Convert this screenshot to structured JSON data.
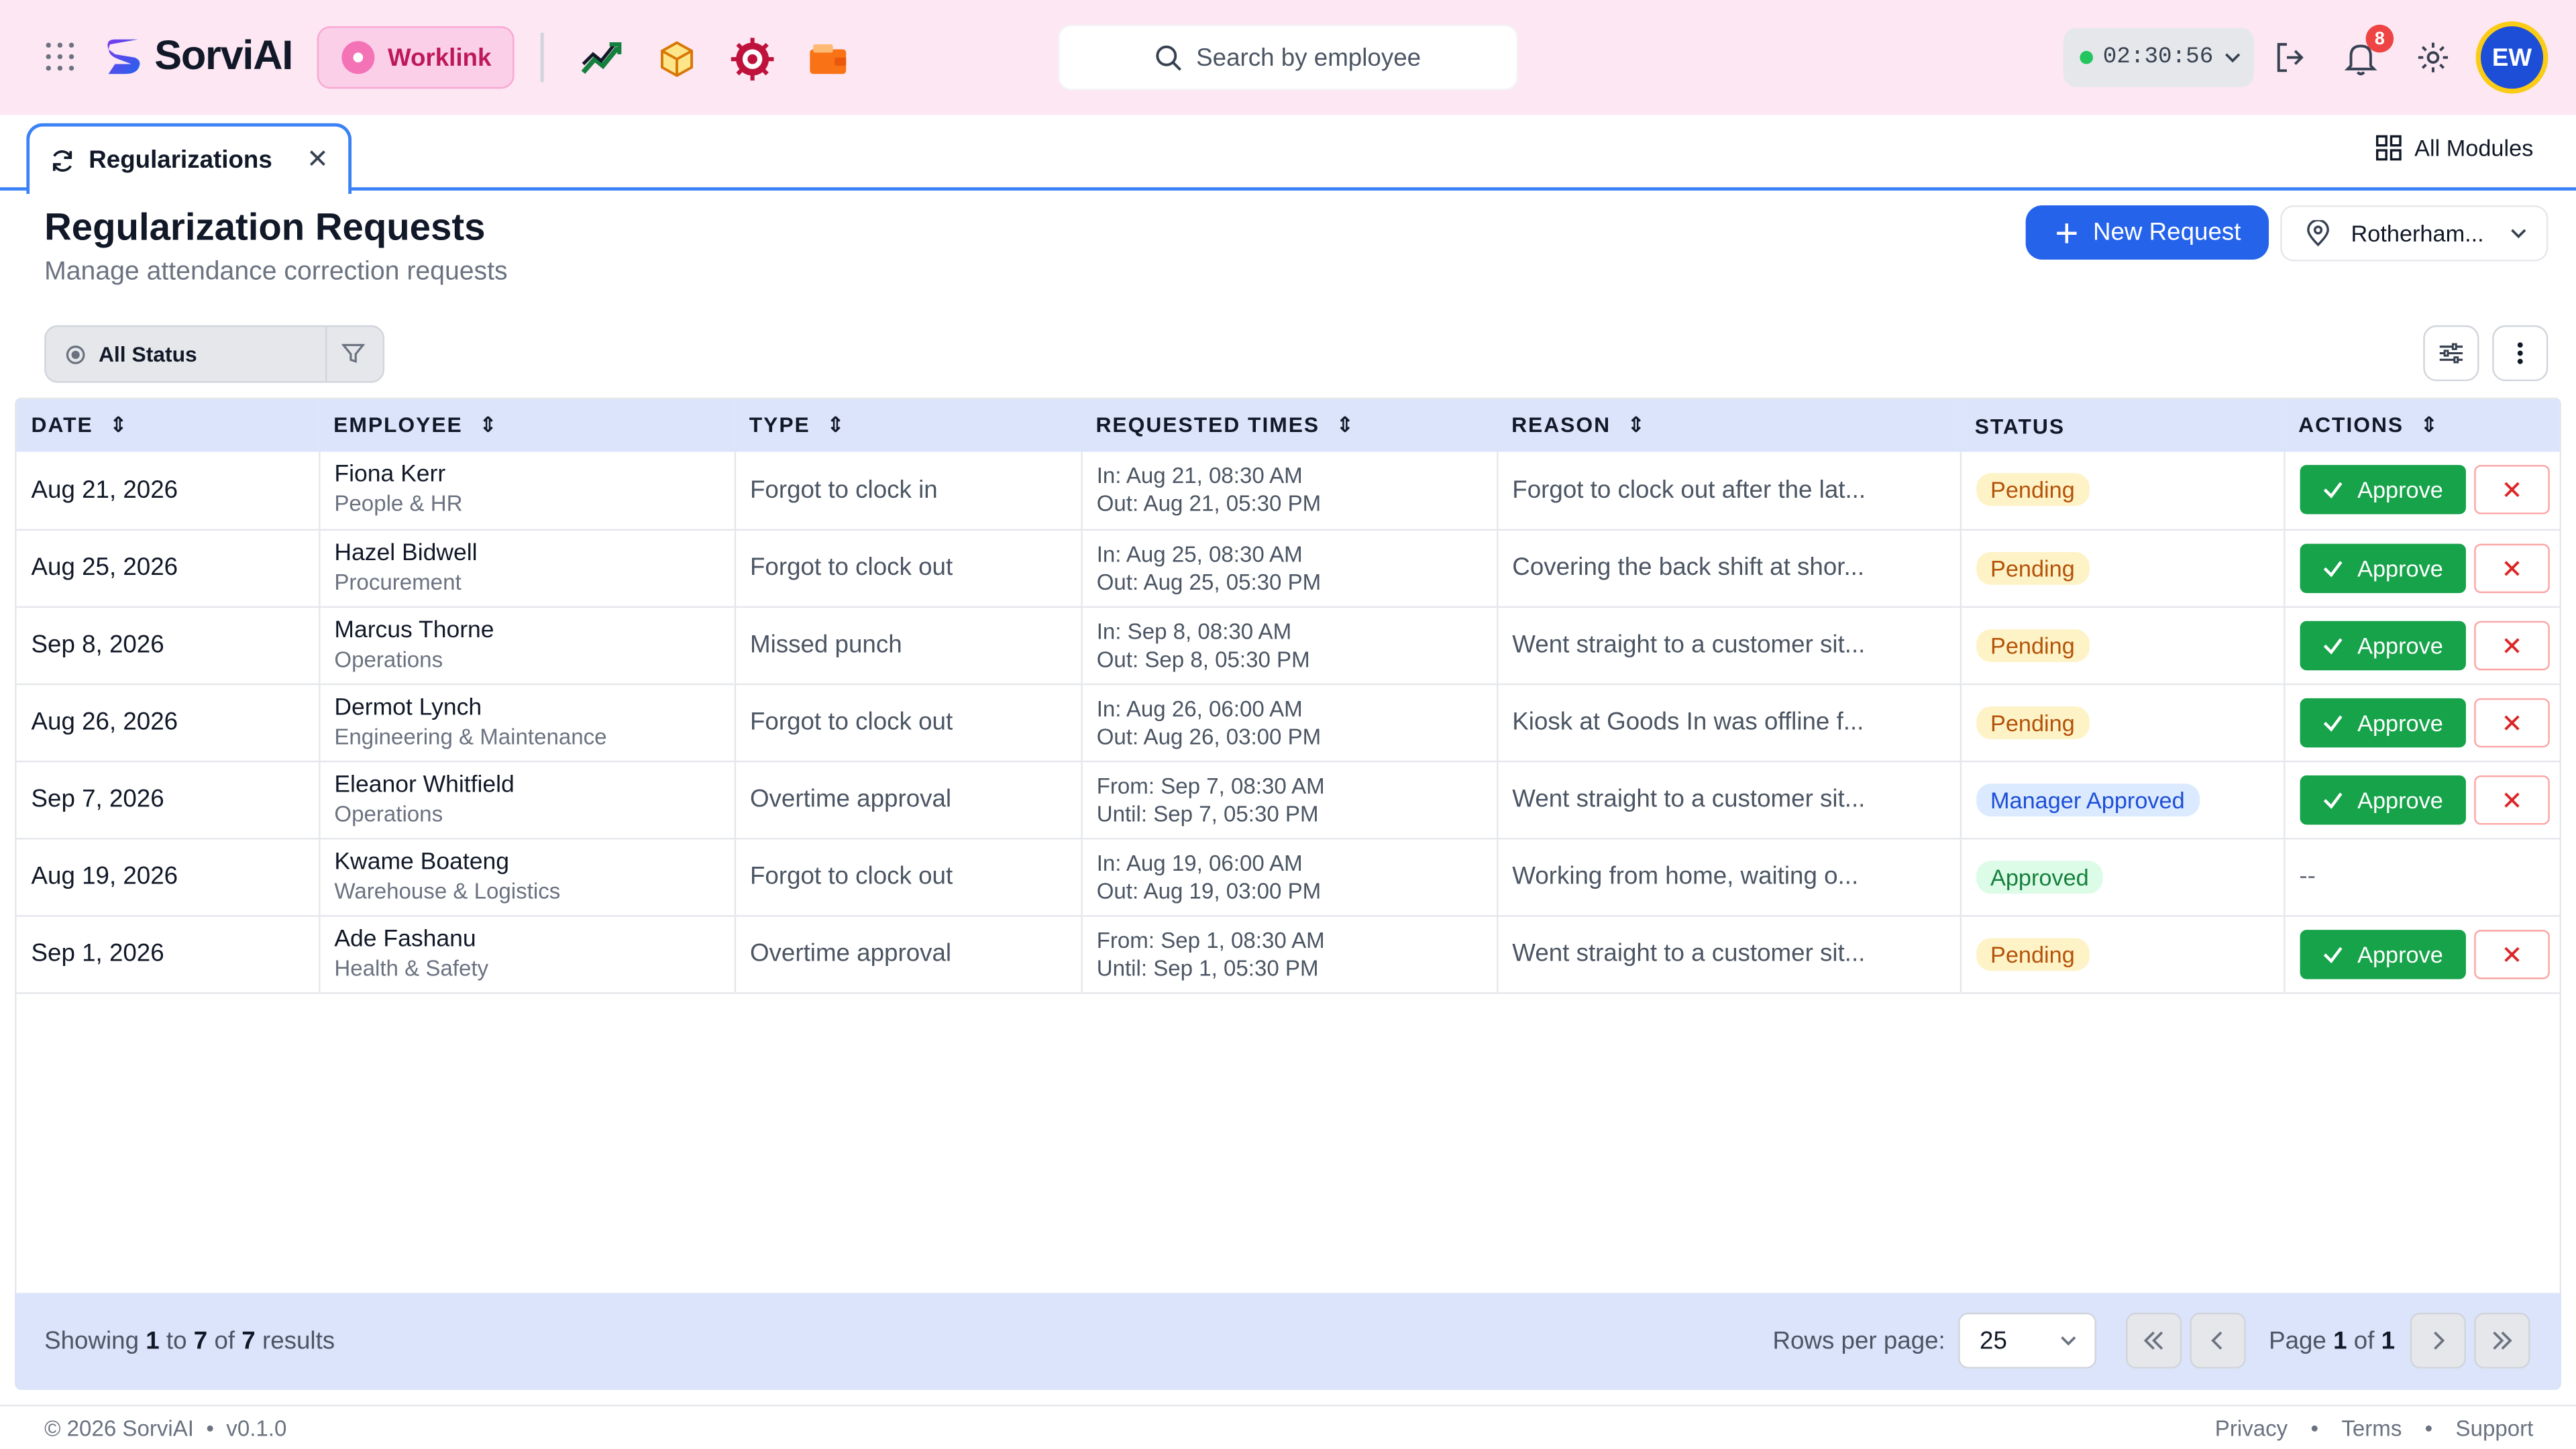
{
  "header": {
    "brand": "SorviAI",
    "app_pill": "Worklink",
    "search_placeholder": "Search by employee",
    "timer": "02:30:56",
    "notification_count": "8",
    "avatar_initials": "EW",
    "module_icons": [
      "analytics-icon",
      "box-icon",
      "gear-target-icon",
      "wallet-icon"
    ]
  },
  "tabs": {
    "active_label": "Regularizations",
    "all_modules": "All Modules"
  },
  "page": {
    "title": "Regularization Requests",
    "subtitle": "Manage attendance correction requests",
    "new_request": "New Request",
    "location": "Rotherham...",
    "status_filter": "All Status"
  },
  "table": {
    "headers": {
      "date": "DATE",
      "employee": "EMPLOYEE",
      "type": "TYPE",
      "times": "REQUESTED TIMES",
      "reason": "REASON",
      "status": "STATUS",
      "actions": "ACTIONS"
    },
    "approve_label": "Approve",
    "no_actions": "--",
    "rows": [
      {
        "date": "Aug 21, 2026",
        "name": "Fiona Kerr",
        "dept": "People & HR",
        "type": "Forgot to clock in",
        "t1": "In: Aug 21, 08:30 AM",
        "t2": "Out: Aug 21, 05:30 PM",
        "reason": "Forgot to clock out after the lat...",
        "status": "Pending"
      },
      {
        "date": "Aug 25, 2026",
        "name": "Hazel Bidwell",
        "dept": "Procurement",
        "type": "Forgot to clock out",
        "t1": "In: Aug 25, 08:30 AM",
        "t2": "Out: Aug 25, 05:30 PM",
        "reason": "Covering the back shift at shor...",
        "status": "Pending"
      },
      {
        "date": "Sep 8, 2026",
        "name": "Marcus Thorne",
        "dept": "Operations",
        "type": "Missed punch",
        "t1": "In: Sep 8, 08:30 AM",
        "t2": "Out: Sep 8, 05:30 PM",
        "reason": "Went straight to a customer sit...",
        "status": "Pending"
      },
      {
        "date": "Aug 26, 2026",
        "name": "Dermot Lynch",
        "dept": "Engineering & Maintenance",
        "type": "Forgot to clock out",
        "t1": "In: Aug 26, 06:00 AM",
        "t2": "Out: Aug 26, 03:00 PM",
        "reason": "Kiosk at Goods In was offline f...",
        "status": "Pending"
      },
      {
        "date": "Sep 7, 2026",
        "name": "Eleanor Whitfield",
        "dept": "Operations",
        "type": "Overtime approval",
        "t1": "From: Sep 7, 08:30 AM",
        "t2": "Until: Sep 7, 05:30 PM",
        "reason": "Went straight to a customer sit...",
        "status": "Manager Approved"
      },
      {
        "date": "Aug 19, 2026",
        "name": "Kwame Boateng",
        "dept": "Warehouse & Logistics",
        "type": "Forgot to clock out",
        "t1": "In: Aug 19, 06:00 AM",
        "t2": "Out: Aug 19, 03:00 PM",
        "reason": "Working from home, waiting o...",
        "status": "Approved"
      },
      {
        "date": "Sep 1, 2026",
        "name": "Ade Fashanu",
        "dept": "Health & Safety",
        "type": "Overtime approval",
        "t1": "From: Sep 1, 08:30 AM",
        "t2": "Until: Sep 1, 05:30 PM",
        "reason": "Went straight to a customer sit...",
        "status": "Pending"
      }
    ]
  },
  "pagination": {
    "showing_prefix": "Showing",
    "from": "1",
    "to_word": "to",
    "to": "7",
    "of_word": "of",
    "total": "7",
    "results_word": "results",
    "rows_per_page_label": "Rows per page:",
    "rows_per_page": "25",
    "page_word": "Page",
    "page": "1",
    "page_of": "of",
    "pages": "1"
  },
  "footer": {
    "copyright": "© 2026 SorviAI",
    "version": "v0.1.0",
    "links": [
      "Privacy",
      "Terms",
      "Support"
    ]
  }
}
